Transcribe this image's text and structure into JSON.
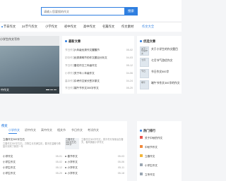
{
  "search": {
    "placeholder": "请输入您要搜的作文",
    "button": "搜索"
  },
  "nav": {
    "items": [
      "节日作文",
      "24节气作文",
      "小学作文",
      "初中作文",
      "高中作文",
      "名篇作文",
      "作文素材",
      "作文大全"
    ],
    "active_index": 7
  },
  "banner": {
    "top_caption": "小学生作文写作",
    "caption": "中作文",
    "slide_count": 3,
    "active_slide": 0
  },
  "latest": {
    "heading": "最新文章",
    "items": [
      {
        "category": "节日作文",
        "title": "六年级优秀作文醒醒节",
        "date": "05-02"
      },
      {
        "category": "初中作文",
        "title": "优秀清明节的作文题目分析文",
        "date": "04-03"
      },
      {
        "category": "节日作文",
        "title": "春花作文三年级作文",
        "date": "05-12"
      },
      {
        "category": "小学作文",
        "title": "关于年八年级作文",
        "date": "04-06"
      },
      {
        "category": "高中作文",
        "title": "中考作文家长签字原文",
        "date": "04-24"
      },
      {
        "category": "节日作文",
        "title": "端午节作文300字作文",
        "date": "05-20"
      }
    ]
  },
  "picks": {
    "heading": "优选文章",
    "items": [
      {
        "thumb": "关于一年级作文",
        "title": "关于小学生的作文题目"
      },
      {
        "thumb": "七月",
        "title": "七月节气游优作文"
      },
      {
        "thumb": "节日",
        "title": "节日作文500字"
      },
      {
        "thumb": "端午",
        "title": "端午节作文300字的作文"
      }
    ]
  },
  "categories": {
    "title": "作文",
    "tabs": [
      "小学作文",
      "初中作文",
      "高中作文",
      "相关节",
      "节日作文",
      "考试作文"
    ],
    "active_tab": 0,
    "cards": [
      {
        "thumb": "立春作文300字左右",
        "desc": "立春作文300字左右，万物生长充满生机，春天在温暖与希望中到来了新的一年",
        "items": [
          {
            "title": "小学作文",
            "date": "05-01"
          },
          {
            "title": "小学生作文",
            "date": "05-02"
          },
          {
            "title": "小学生作文",
            "date": "05-12"
          },
          {
            "title": "小学生作文",
            "date": "05-20"
          }
        ]
      },
      {
        "thumb": "立春作文300字左右 300字",
        "desc": "立春作文300字作文，寒冷冬天渐渐远去春天，春风拂面小学作文",
        "items": [
          {
            "title": "春节作文",
            "date": "05-03"
          },
          {
            "title": "小学作文",
            "date": "05-06"
          },
          {
            "title": "小学作文",
            "date": "05-11"
          },
          {
            "title": "小学作文",
            "date": "05-18"
          }
        ]
      }
    ]
  },
  "hot": {
    "heading": "热门排行",
    "items": [
      "关于中秋的作文",
      "中秋节作文",
      "立春作文",
      "小学生作文",
      "立冬作文"
    ],
    "colors": [
      "#e8554e",
      "#f08a3c",
      "#f2b53a",
      "#9aa5b1",
      "#9aa5b1"
    ]
  },
  "colors": {
    "accent": "#2f7fe0"
  }
}
